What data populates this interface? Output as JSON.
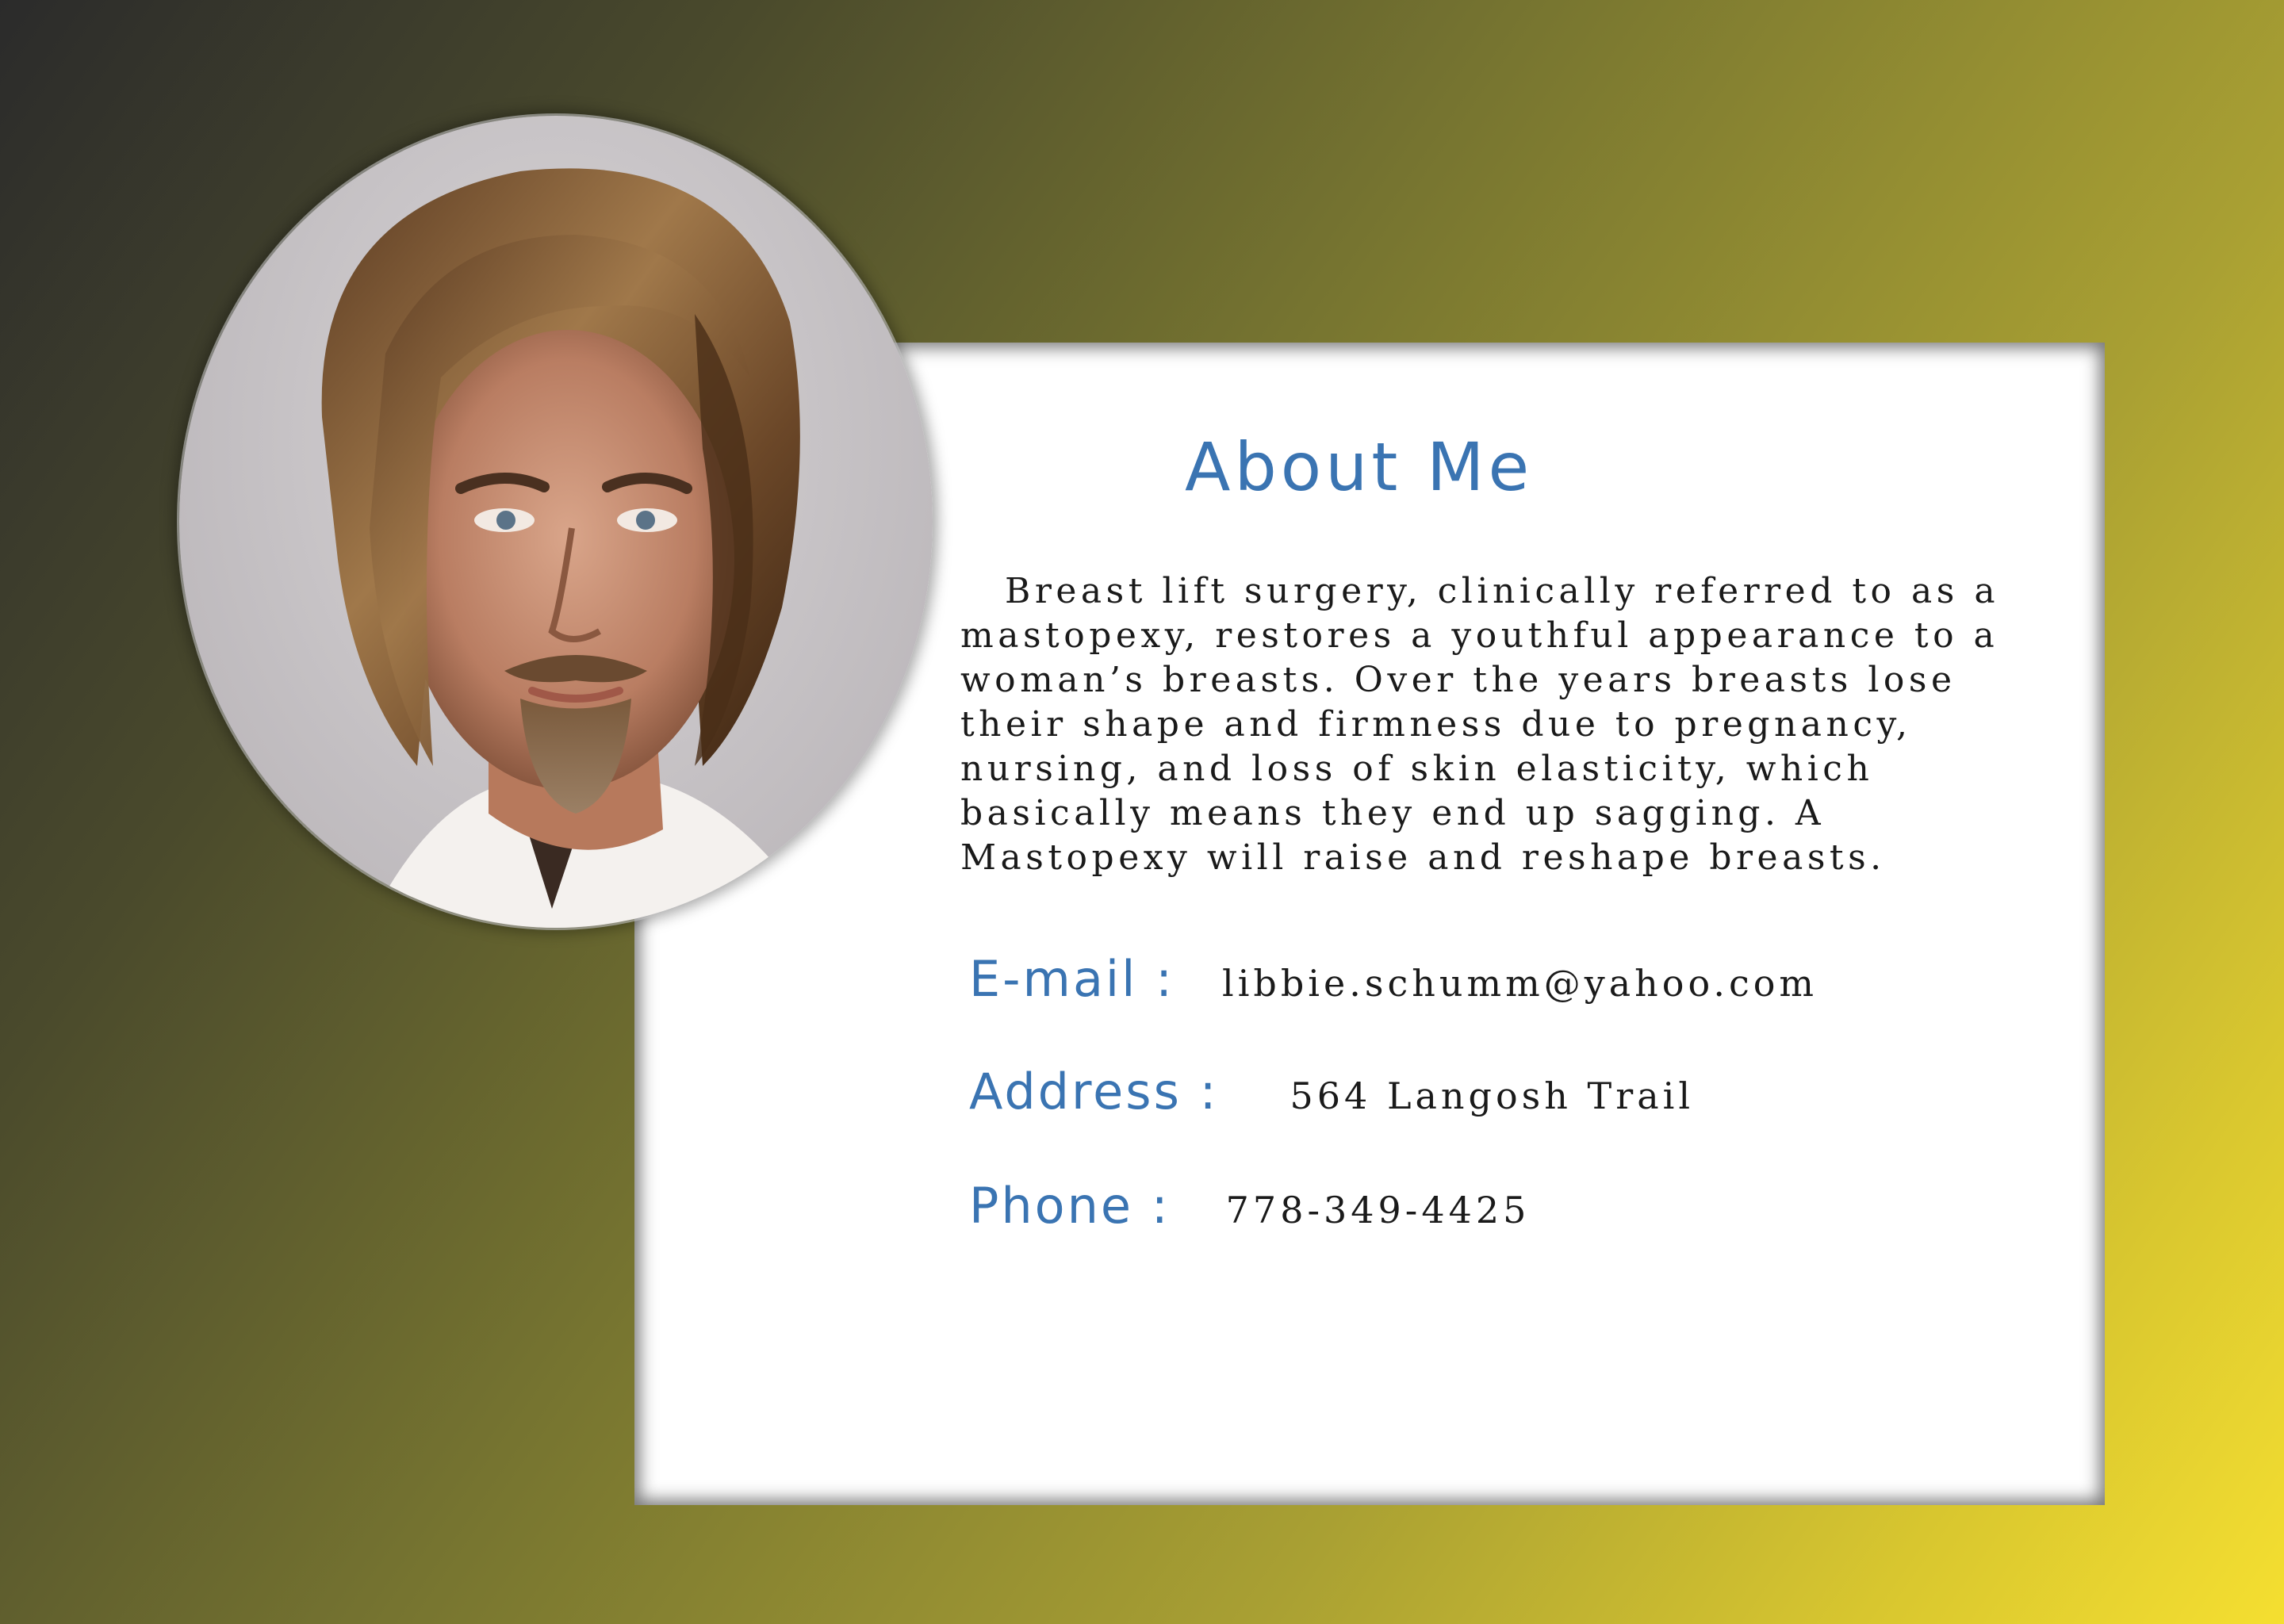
{
  "about": {
    "title": "About Me",
    "bio": "Breast lift surgery, clinically referred to as a mastopexy, restores a youthful appearance to a woman’s breasts. Over the years breasts lose their shape and firmness due to pregnancy, nursing, and loss of skin elasticity, which basically means they end up sagging. A Mastopexy will raise and reshape breasts."
  },
  "contact": {
    "email_label": "E-mail :",
    "email": "libbie.schumm@yahoo.com",
    "address_label": "Address :",
    "address": "564 Langosh Trail",
    "phone_label": "Phone :",
    "phone": "778-349-4425"
  },
  "colors": {
    "accent": "#3a74b2",
    "card": "#ffffff",
    "gradient_start": "#2b2b2b",
    "gradient_end": "#f5df30"
  },
  "portrait": {
    "icon": "profile-photo"
  }
}
